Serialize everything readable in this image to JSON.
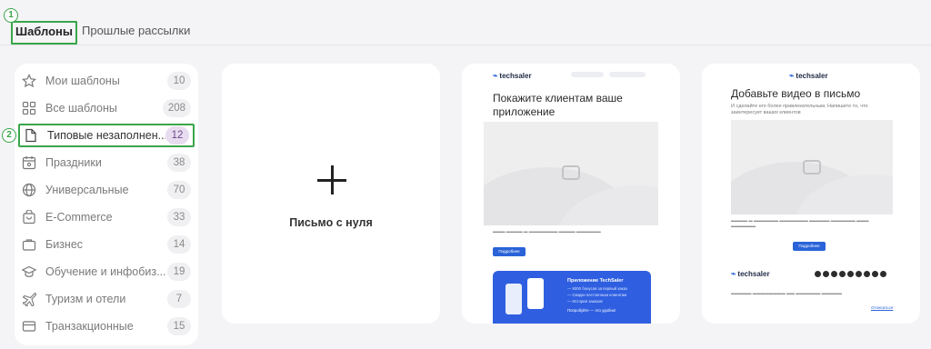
{
  "markers": {
    "one": "1",
    "two": "2"
  },
  "tabs": [
    {
      "label": "Шаблоны",
      "active": true
    },
    {
      "label": "Прошлые рассылки",
      "active": false
    }
  ],
  "sidebar": {
    "items": [
      {
        "label": "Мои шаблоны",
        "count": "10",
        "icon": "star-icon"
      },
      {
        "label": "Все шаблоны",
        "count": "208",
        "icon": "grid-icon"
      },
      {
        "label": "Типовые незаполнен...",
        "count": "12",
        "icon": "document-icon",
        "active": true
      },
      {
        "label": "Праздники",
        "count": "38",
        "icon": "calendar-icon"
      },
      {
        "label": "Универсальные",
        "count": "70",
        "icon": "globe-icon"
      },
      {
        "label": "E-Commerce",
        "count": "33",
        "icon": "shopping-bag-icon"
      },
      {
        "label": "Бизнес",
        "count": "14",
        "icon": "briefcase-icon"
      },
      {
        "label": "Обучение и инфобиз...",
        "count": "19",
        "icon": "graduation-cap-icon"
      },
      {
        "label": "Туризм и отели",
        "count": "7",
        "icon": "airplane-icon"
      },
      {
        "label": "Транзакционные",
        "count": "15",
        "icon": "credit-card-icon"
      }
    ]
  },
  "blank_card": {
    "title": "Письмо с нуля",
    "icon": "plus-icon"
  },
  "template1": {
    "brand": "techsaler",
    "title": "Покажите клиентам ваше приложение",
    "button": "Подробнее",
    "promo_title": "Приложение TechSaler",
    "promo_lines": [
      "— 5000 бонусов за первый заказ",
      "— Скидки постоянным клиентам",
      "— История заказов"
    ],
    "promo_link": "Попробуйте — это удобно!"
  },
  "template2": {
    "brand": "techsaler",
    "title": "Добавьте видео в письмо",
    "subtitle": "И сделайте его более привлекательным. Напишите то, что заинтересует ваших клиентов",
    "button": "Подробнее",
    "footer_link": "Отписаться"
  },
  "colors": {
    "accent_green": "#3aa54a",
    "brand_blue": "#2a63d8",
    "active_badge": "#e8dcf0"
  }
}
